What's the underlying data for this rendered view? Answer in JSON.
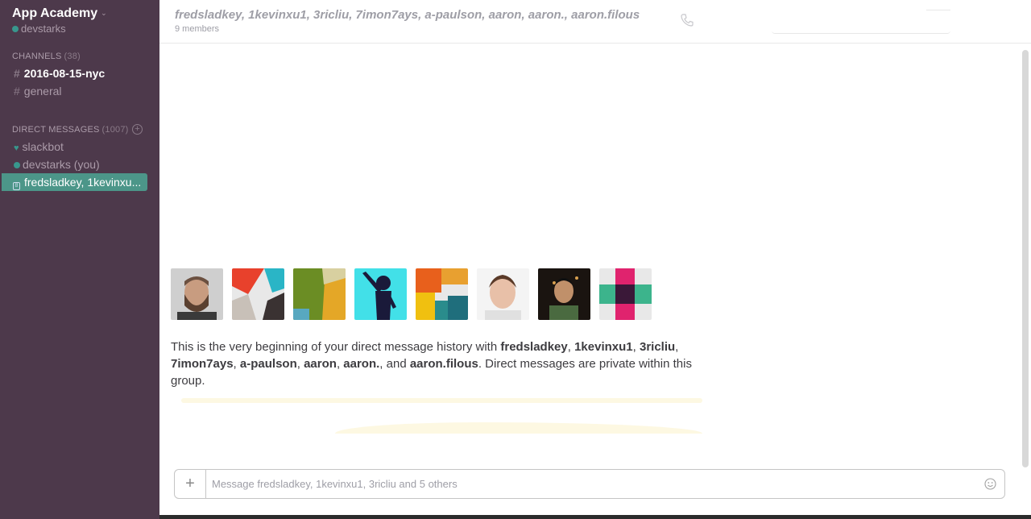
{
  "sidebar": {
    "team_name": "App Academy",
    "username": "devstarks",
    "channels_title": "CHANNELS",
    "channels_count": "(38)",
    "channels": [
      {
        "label": "2016-08-15-nyc"
      },
      {
        "label": "general"
      }
    ],
    "dm_title": "DIRECT MESSAGES",
    "dm_count": "(1007)",
    "dms": [
      {
        "label": "slackbot"
      },
      {
        "label": "devstarks (you)"
      },
      {
        "label": "fredsladkey, 1kevinxu..."
      }
    ]
  },
  "header": {
    "title": "fredsladkey, 1kevinxu1, 3ricliu, 7imon7ays, a-paulson, aaron, aaron., aaron.filous",
    "members": "9 members"
  },
  "intro": {
    "prefix": "This is the very beginning of your direct message history with ",
    "names": [
      "fredsladkey",
      "1kevinxu1",
      "3ricliu",
      "7imon7ays",
      "a-paulson",
      "aaron",
      "aaron."
    ],
    "and_text": ", and ",
    "last_name": "aaron.filous",
    "suffix": ". Direct messages are private within this group."
  },
  "composer": {
    "placeholder": "Message fredsladkey, 1kevinxu1, 3ricliu and 5 others",
    "add_label": "+"
  }
}
